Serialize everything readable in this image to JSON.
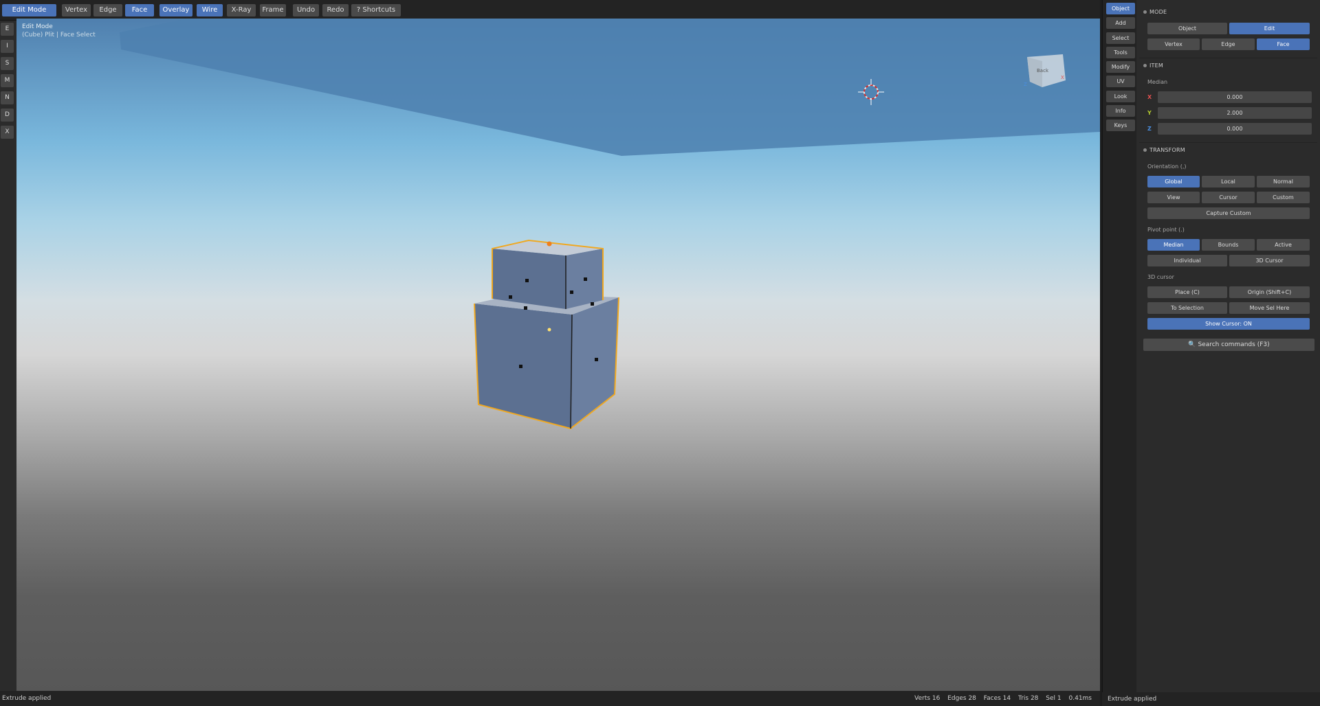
{
  "toolbar": {
    "mode": "Edit Mode",
    "vertex": "Vertex",
    "edge": "Edge",
    "face": "Face",
    "overlay": "Overlay",
    "wire": "Wire",
    "xray": "X-Ray",
    "frame": "Frame",
    "undo": "Undo",
    "redo": "Redo",
    "shortcuts": "?  Shortcuts"
  },
  "left_tools": [
    "E",
    "I",
    "S",
    "M",
    "N",
    "D",
    "X"
  ],
  "viewport": {
    "mode_label": "Edit Mode",
    "info_label": "(Cube) Plit | Face Select",
    "gizmo": {
      "back": "Back",
      "z": "Z",
      "x": "X"
    },
    "accent_selection": "#f5a623"
  },
  "status": {
    "message": "Extrude applied",
    "verts": "Verts 16",
    "edges": "Edges 28",
    "faces": "Faces 14",
    "tris": "Tris 28",
    "sel": "Sel 1",
    "time": "0.41ms"
  },
  "side_tabs": [
    "Object",
    "Add",
    "Select",
    "Tools",
    "Modify",
    "UV",
    "Look",
    "Info",
    "Keys"
  ],
  "panel": {
    "mode": {
      "header": "MODE",
      "object": "Object",
      "edit": "Edit",
      "vertex": "Vertex",
      "edge": "Edge",
      "face": "Face"
    },
    "item": {
      "header": "ITEM",
      "median_label": "Median",
      "x_label": "X",
      "x_value": "0.000",
      "y_label": "Y",
      "y_value": "2.000",
      "z_label": "Z",
      "z_value": "0.000"
    },
    "transform": {
      "header": "TRANSFORM",
      "orientation_label": "Orientation  (,)",
      "global": "Global",
      "local": "Local",
      "normal": "Normal",
      "view": "View",
      "cursor": "Cursor",
      "custom": "Custom",
      "capture_custom": "Capture Custom",
      "pivot_label": "Pivot point  (.)",
      "median": "Median",
      "bounds": "Bounds",
      "active": "Active",
      "individual": "Individual",
      "cursor3d": "3D Cursor",
      "cursor_label": "3D cursor",
      "place": "Place  (C)",
      "origin": "Origin  (Shift+C)",
      "to_selection": "To Selection",
      "move_sel_here": "Move Sel Here",
      "show_cursor": "Show Cursor: ON"
    },
    "search": "🔍  Search commands  (F3)",
    "status": "Extrude applied"
  },
  "colors": {
    "accent": "#4a73b8",
    "axis_x": "#e05050",
    "axis_y": "#b5cc30",
    "axis_z": "#4a8fe0"
  }
}
